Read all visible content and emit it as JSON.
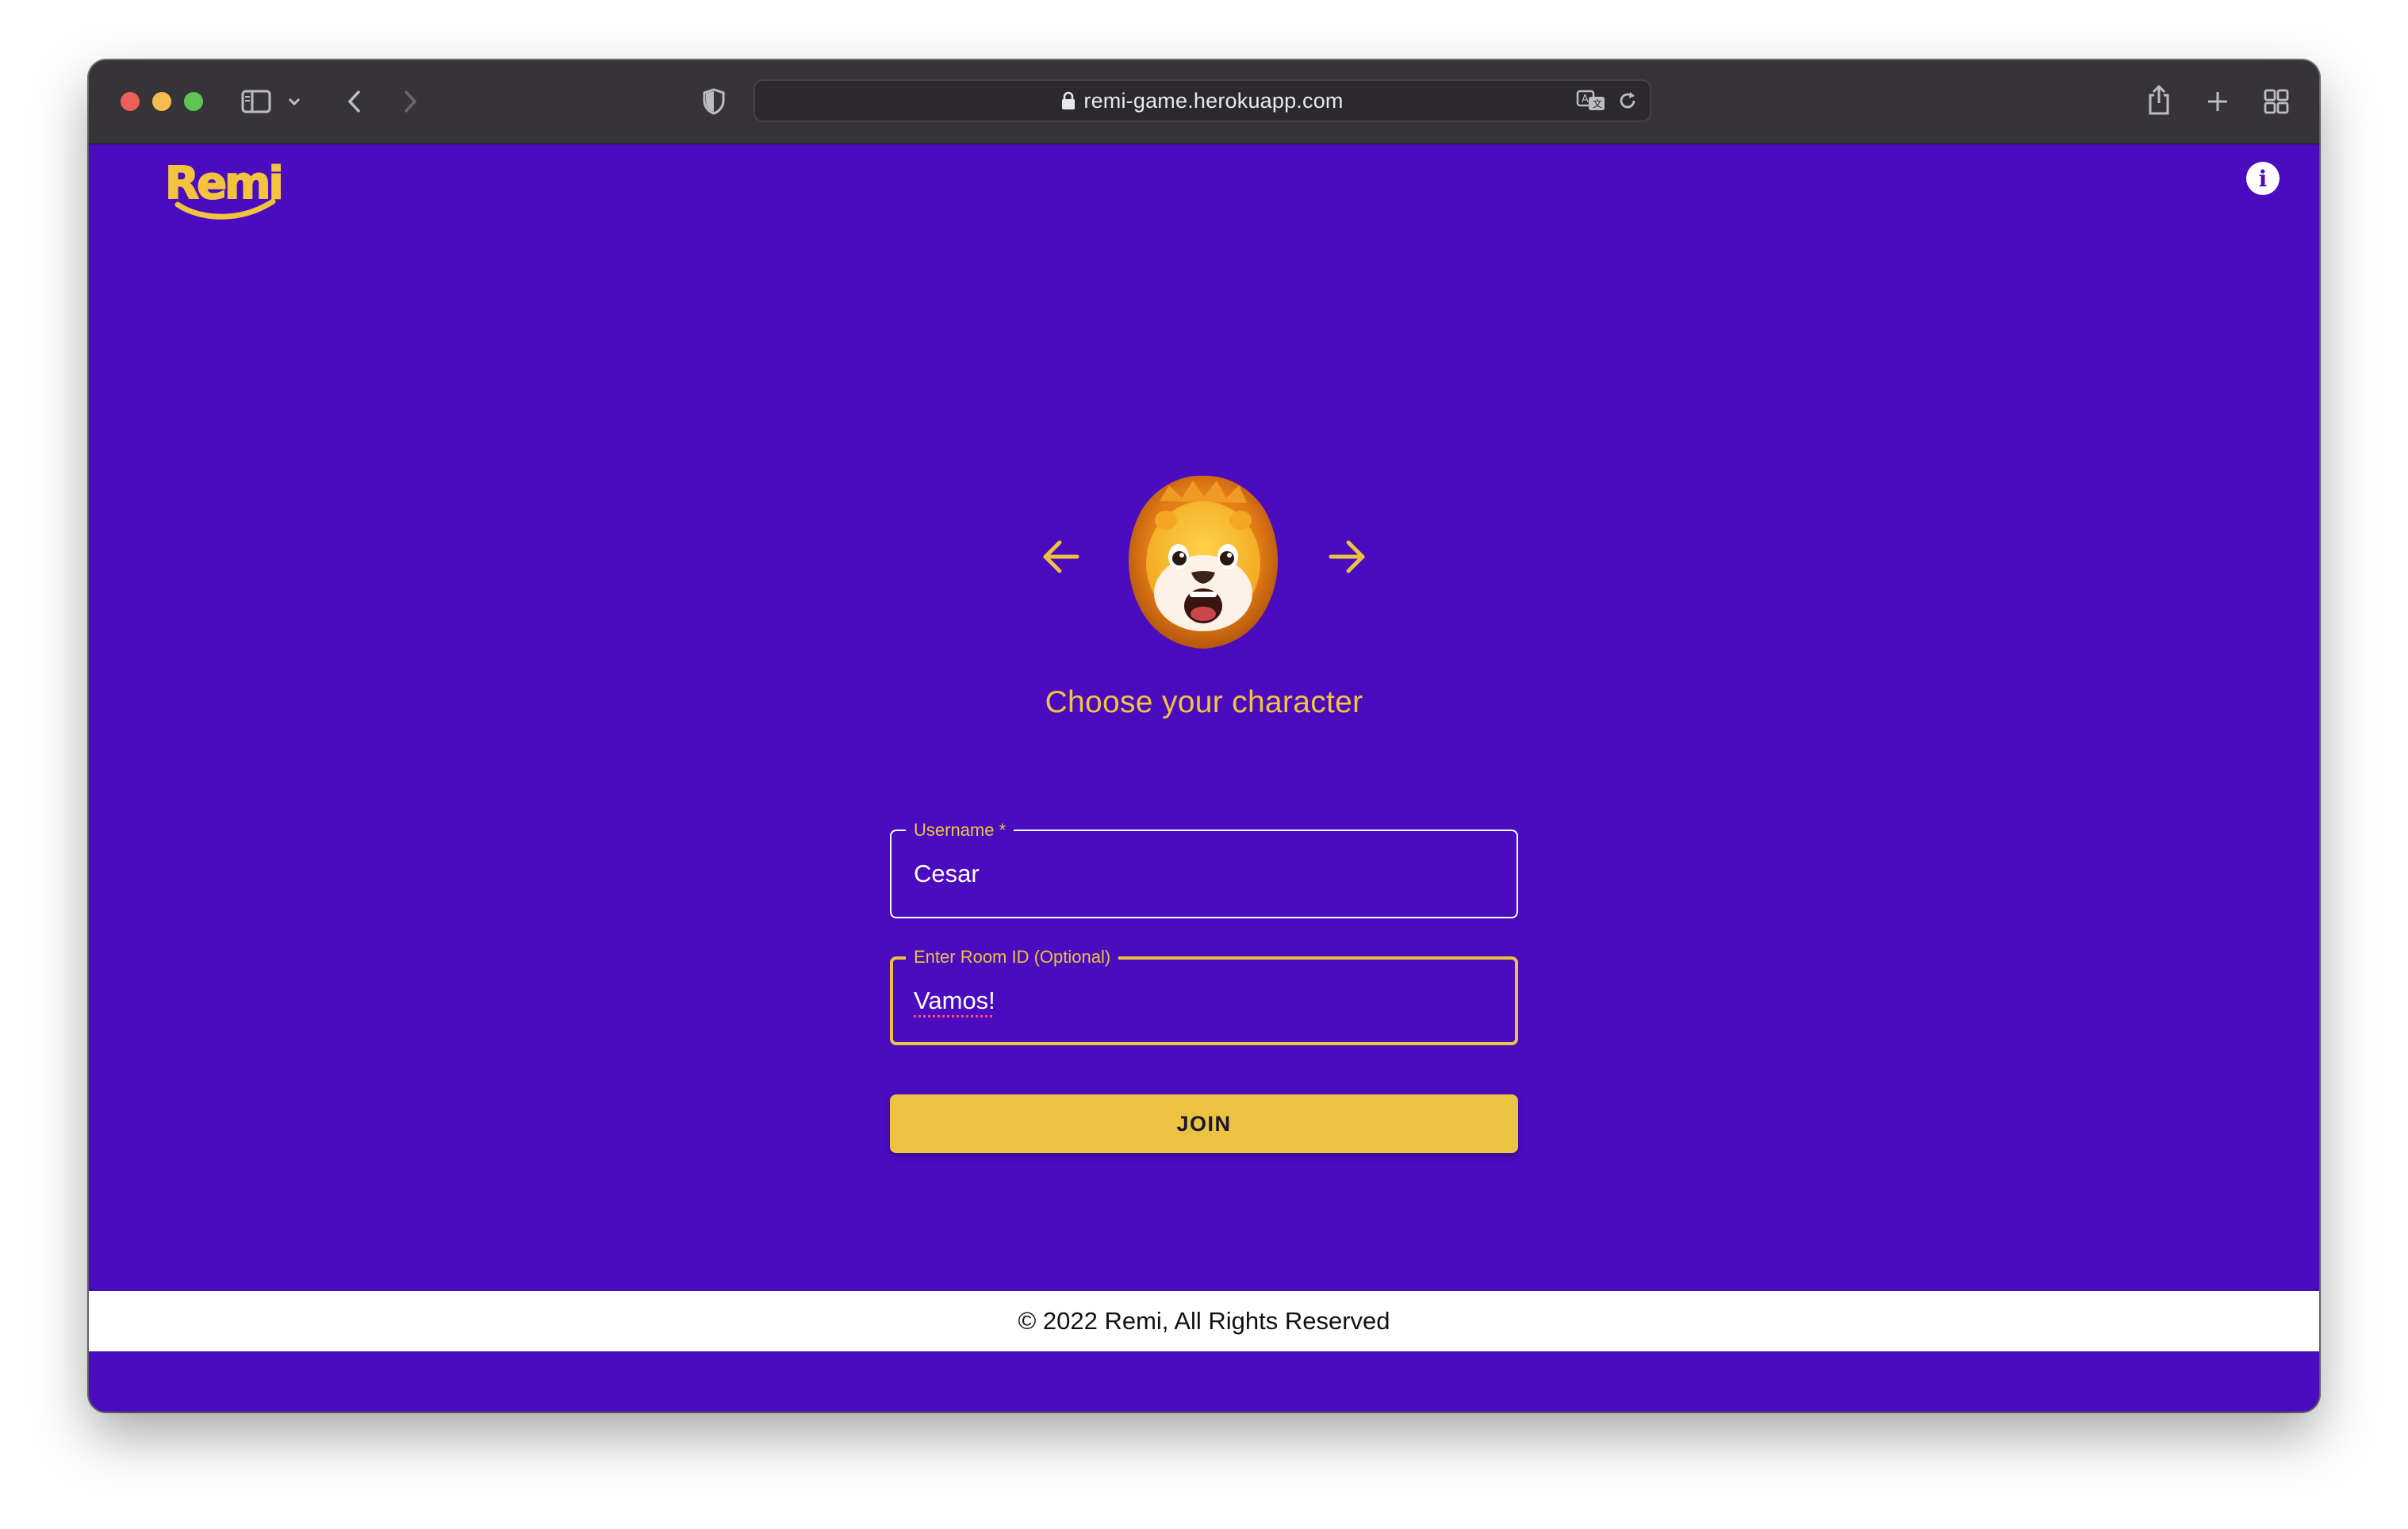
{
  "browser": {
    "url": "remi-game.herokuapp.com"
  },
  "app": {
    "logo_text": "Remi",
    "info_icon": "i"
  },
  "character": {
    "heading": "Choose your character",
    "prev_icon": "arrow-left-icon",
    "next_icon": "arrow-right-icon",
    "avatar": "lion-avatar"
  },
  "form": {
    "username_label": "Username *",
    "username_value": "Cesar",
    "room_label": "Enter Room ID (Optional)",
    "room_value": "Vamos!",
    "join_label": "JOIN"
  },
  "footer": {
    "text": "© 2022 Remi, All Rights Reserved"
  },
  "colors": {
    "background": "#4b0bbf",
    "accent": "#ebc340",
    "footer_bg": "#ffffff"
  }
}
